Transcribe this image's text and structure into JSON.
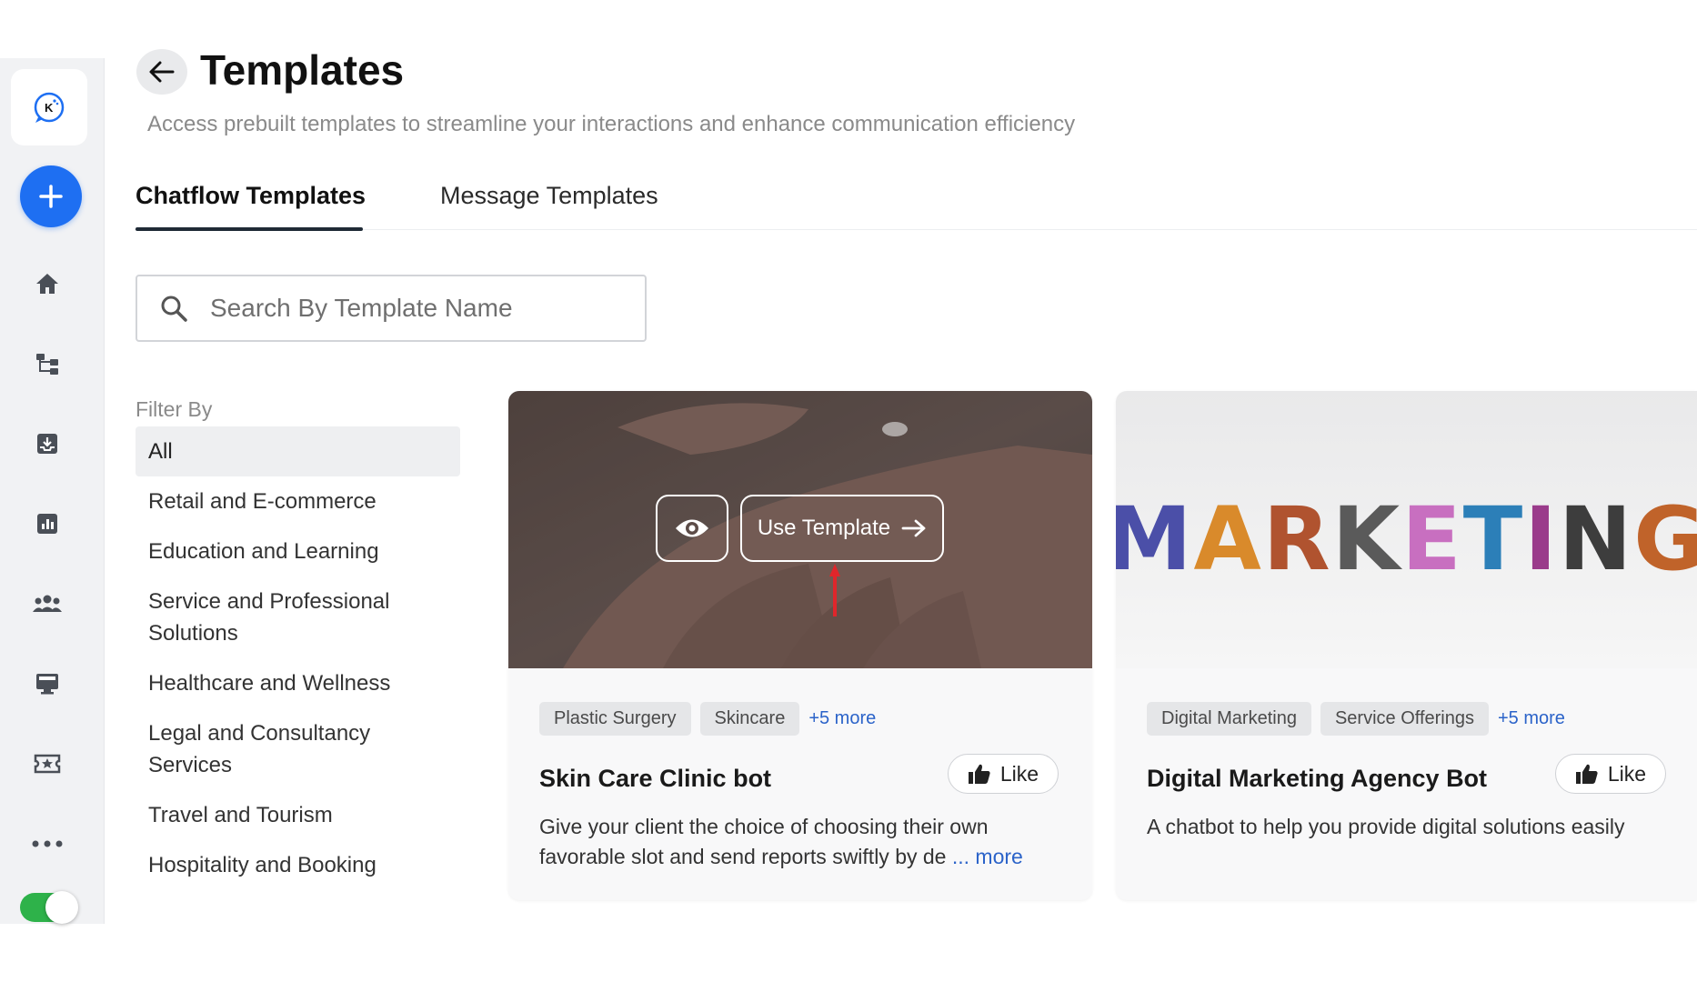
{
  "header": {
    "title": "Templates",
    "subtitle": "Access prebuilt templates to streamline your interactions and enhance communication efficiency"
  },
  "tabs": [
    {
      "label": "Chatflow Templates",
      "active": true
    },
    {
      "label": "Message Templates",
      "active": false
    }
  ],
  "search": {
    "placeholder": "Search By Template Name",
    "value": ""
  },
  "filter": {
    "label": "Filter By",
    "items": [
      "All",
      "Retail and E-commerce",
      "Education and Learning",
      "Service and Professional Solutions",
      "Healthcare and Wellness",
      "Legal and Consultancy Services",
      "Travel and Tourism",
      "Hospitality and Booking"
    ],
    "selected": "All"
  },
  "cards": [
    {
      "tags": [
        "Plastic Surgery",
        "Skincare"
      ],
      "more_tags": "+5 more",
      "title": "Skin Care Clinic bot",
      "like_label": "Like",
      "description_line1": "Give your client the choice of choosing their own",
      "description_line2": "favorable slot and send reports swiftly by de",
      "description_more": "... more",
      "use_template_label": "Use Template"
    },
    {
      "tags": [
        "Digital Marketing",
        "Service Offerings"
      ],
      "more_tags": "+5 more",
      "title": "Digital Marketing Agency Bot",
      "like_label": "Like",
      "description_line1": "A chatbot to help you provide digital solutions easily",
      "image_text": "MARKETING"
    }
  ],
  "sidebar": {
    "logo_letter": "K",
    "icons": [
      "home-icon",
      "flow-icon",
      "inbox-icon",
      "analytics-icon",
      "contacts-icon",
      "broadcast-icon",
      "ticket-icon",
      "more-icon"
    ]
  },
  "colors": {
    "accent": "#1e6ff2",
    "link": "#2b63c9",
    "toggle": "#2eb24a"
  }
}
